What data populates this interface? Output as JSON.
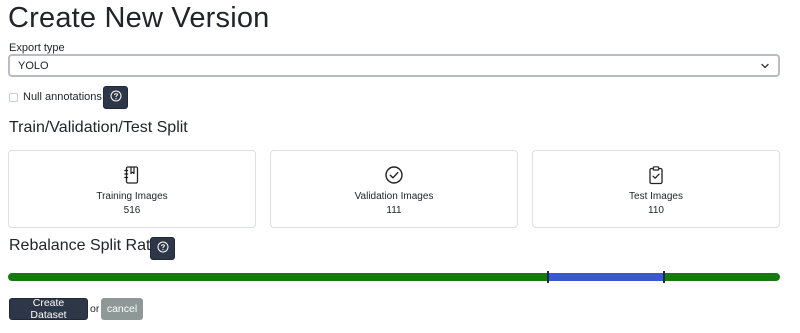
{
  "page": {
    "title": "Create New Version"
  },
  "export": {
    "label": "Export type",
    "selected": "YOLO",
    "icon": "chevron-down-icon"
  },
  "null_annotations": {
    "label": "Null annotations",
    "checked": false,
    "help_icon": "question-circle-icon"
  },
  "split": {
    "title": "Train/Validation/Test Split",
    "cards": [
      {
        "label": "Training Images",
        "count": "516",
        "icon": "notebook-icon"
      },
      {
        "label": "Validation Images",
        "count": "111",
        "icon": "check-circle-icon"
      },
      {
        "label": "Test Images",
        "count": "110",
        "icon": "clipboard-check-icon"
      }
    ]
  },
  "rebalance": {
    "title": "Rebalance Split Ratio",
    "help_icon": "question-circle-icon",
    "slider": {
      "train_fraction": 0.7,
      "validation_fraction": 0.15,
      "test_fraction": 0.15,
      "colors": {
        "train": "#167a11",
        "validation": "#3a56d1",
        "test": "#167a11",
        "handle": "#1e2a4a"
      }
    }
  },
  "actions": {
    "create_label": "Create Dataset",
    "or_text": "or",
    "cancel_label": "cancel"
  },
  "colors": {
    "primary": "#2d3748",
    "cancel": "#8e9896",
    "text": "#212529"
  }
}
